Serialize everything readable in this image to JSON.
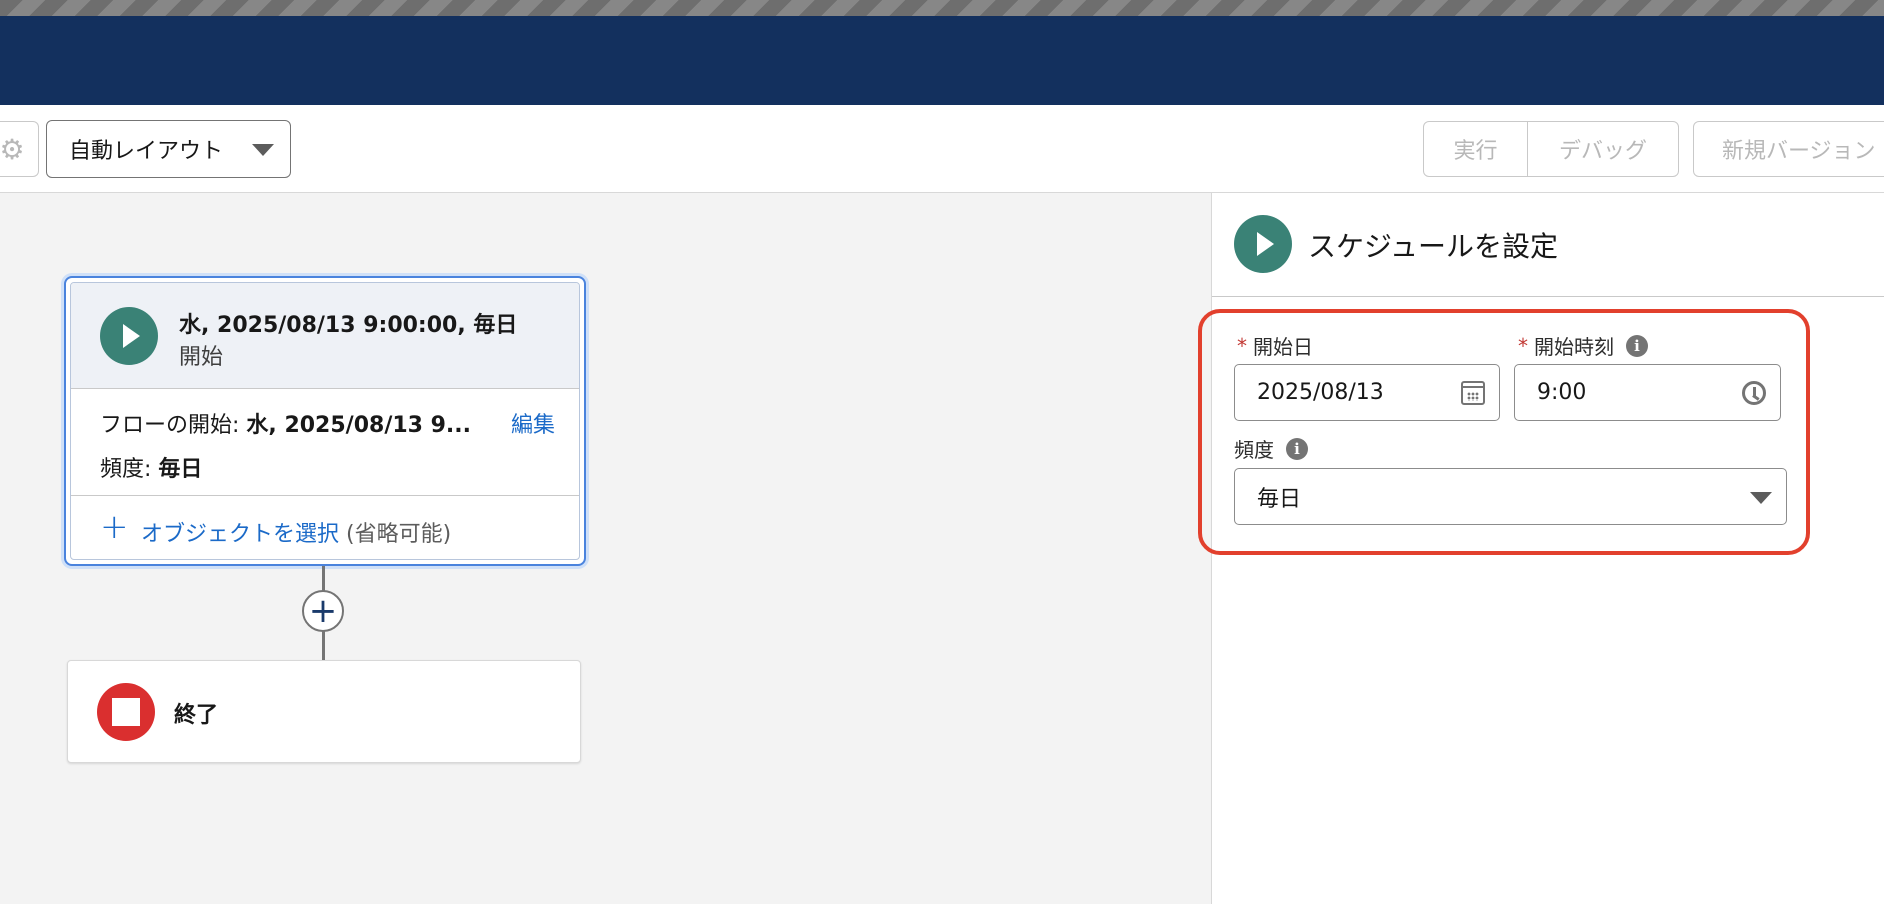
{
  "toolbar": {
    "settings_icon": "gear-icon",
    "layout_select": "自動レイアウト",
    "run_label": "実行",
    "debug_label": "デバッグ",
    "new_version_label": "新規バージョン"
  },
  "canvas": {
    "start_node": {
      "title": "水, 2025/08/13 9:00:00, 毎日",
      "subtitle": "開始",
      "flow_start_label": "フローの開始:",
      "flow_start_value": "水, 2025/08/13 9...",
      "edit_label": "編集",
      "frequency_label": "頻度:",
      "frequency_value": "毎日",
      "add_object_label": "オブジェクトを選択",
      "optional_label": "(省略可能)"
    },
    "add_element_icon": "plus-icon",
    "end_node": {
      "label": "終了"
    }
  },
  "panel": {
    "title": "スケジュールを設定",
    "start_date": {
      "label": "開始日",
      "value": "2025/08/13",
      "required": true
    },
    "start_time": {
      "label": "開始時刻",
      "value": "9:00",
      "required": true
    },
    "frequency": {
      "label": "頻度",
      "value": "毎日"
    }
  },
  "colors": {
    "navbar": "#13305e",
    "start_icon": "#3a8276",
    "end_icon": "#da2f2f",
    "link": "#1b6ac8",
    "highlight": "#e2402d"
  }
}
